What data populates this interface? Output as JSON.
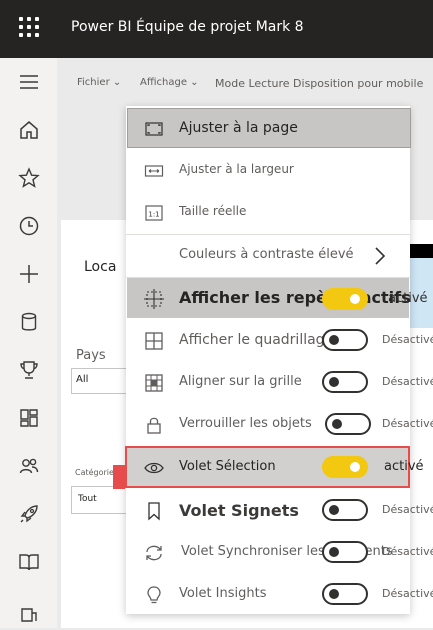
{
  "header": {
    "title": "Power BI Équipe de projet Mark 8"
  },
  "nav": {
    "icons": [
      "hamburger-icon",
      "home-icon",
      "star-icon",
      "clock-icon",
      "plus-icon",
      "database-icon",
      "trophy-icon",
      "dashboard-icon",
      "people-icon",
      "rocket-icon",
      "book-icon",
      "workspace-icon"
    ]
  },
  "toolbar": {
    "file": "Fichier",
    "view": "Affichage",
    "rest": "Mode Lecture Disposition pour mobile"
  },
  "report": {
    "title": "Loca",
    "pays_label": "Pays",
    "pays_value": "All",
    "category_label": "Catégorie de pro",
    "category_value": "Tout"
  },
  "menu": {
    "fit_page": "Ajuster à la page",
    "fit_width": "Ajuster à la largeur",
    "actual_size": "Taille réelle",
    "high_contrast": "Couleurs à contraste élevé",
    "show_guides": "Afficher les repères actifs",
    "show_guides_state": "activé",
    "show_gridlines": "Afficher le quadrillage",
    "show_gridlines_state": "Désactivé",
    "snap_grid": "Aligner sur la grille",
    "snap_grid_state": "Désactivé",
    "lock_objects": "Verrouiller les objets",
    "lock_objects_state": "Désactivé",
    "selection_pane": "Volet Sélection",
    "selection_pane_state": "activé",
    "bookmarks_pane": "Volet Signets",
    "bookmarks_pane_state": "Désactivé",
    "sync_slicers": "Volet Synchroniser les segments",
    "sync_slicers_state": "Désactivé",
    "insights_pane": "Volet Insights",
    "insights_pane_state": "Désactivé"
  },
  "colors": {
    "topbar": "#252423",
    "toggle_on": "#f2c811",
    "highlight_border": "#e74c4c"
  }
}
